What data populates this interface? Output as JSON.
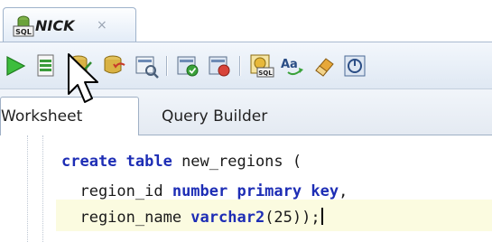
{
  "document_tab": {
    "title": "NICK",
    "close_glyph": "×",
    "icon": "sql-connection-icon",
    "icon_text": "SQL"
  },
  "toolbar": {
    "icons": [
      "run-statement-icon",
      "run-script-icon",
      "commit-icon",
      "rollback-icon",
      "explain-plan-icon",
      "autotrace-icon",
      "sql-tuning-icon",
      "sql-history-icon",
      "format-case-icon",
      "clear-eraser-icon",
      "sql-tuning-advisor-icon"
    ]
  },
  "subtabs": {
    "worksheet": "Worksheet",
    "query_builder": "Query Builder"
  },
  "editor": {
    "line1": {
      "kw1": "create table",
      "rest": " new_regions ("
    },
    "line2": {
      "a": "  region_id ",
      "kw": "number primary key",
      "b": ","
    },
    "line3": {
      "a": "  region_name ",
      "kw": "varchar2",
      "b": "(25));"
    }
  },
  "colors": {
    "keyword": "#1d2db5",
    "current_line": "#fbfbe0",
    "toolbar_bg": "#e6edf6"
  }
}
